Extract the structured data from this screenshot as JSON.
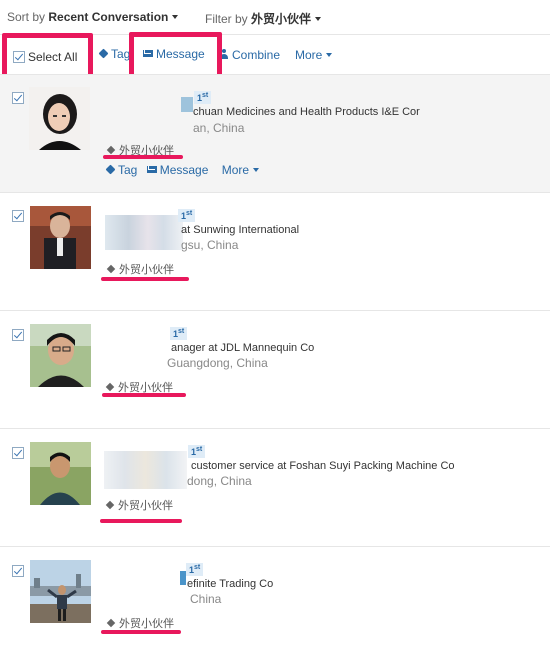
{
  "toolbar": {
    "sort_label": "Sort by",
    "sort_value": "Recent Conversation",
    "filter_label": "Filter by",
    "filter_value": "外贸小伙伴"
  },
  "actions": {
    "select_all": "Select All",
    "tag": "Tag",
    "message": "Message",
    "combine": "Combine",
    "more": "More"
  },
  "connections": [
    {
      "degree": "1",
      "degree_suffix": "st",
      "title": "chuan Medicines and Health Products I&E Cor",
      "location": "an, China",
      "tag": "外贸小伙伴",
      "actions": {
        "tag": "Tag",
        "message": "Message",
        "more": "More"
      }
    },
    {
      "degree": "1",
      "degree_suffix": "st",
      "title": "at Sunwing International",
      "location": "gsu, China",
      "tag": "外贸小伙伴"
    },
    {
      "degree": "1",
      "degree_suffix": "st",
      "title": "anager at JDL Mannequin Co",
      "location": "Guangdong, China",
      "tag": "外贸小伙伴"
    },
    {
      "degree": "1",
      "degree_suffix": "st",
      "title": "customer service at Foshan Suyi Packing Machine Co",
      "location": "dong, China",
      "tag": "外贸小伙伴"
    },
    {
      "degree": "1",
      "degree_suffix": "st",
      "title": "efinite Trading Co",
      "location": "China",
      "tag": "外贸小伙伴"
    }
  ],
  "colors": {
    "link": "#2a6aa6",
    "highlight": "#e8185c",
    "degree_bg": "#dfecf7"
  }
}
